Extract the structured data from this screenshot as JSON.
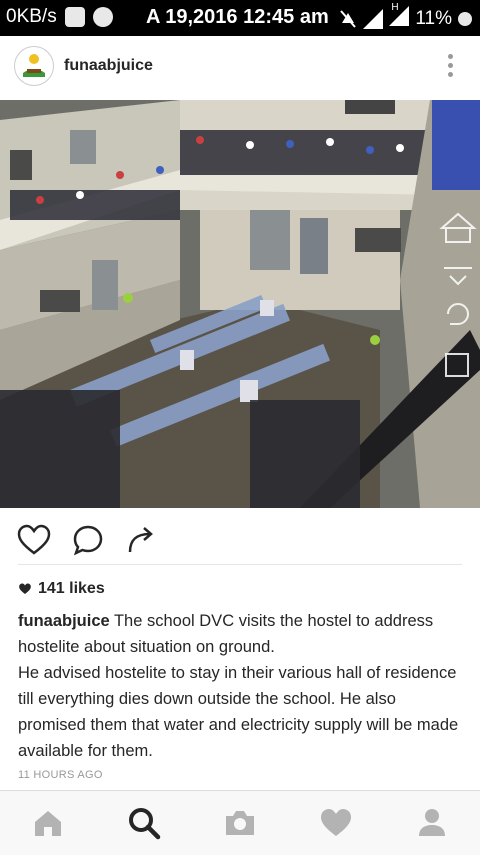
{
  "statusbar": {
    "data_text": "0KB/s",
    "datetime": "A 19,2016 12:45 am",
    "network": "H",
    "battery": "11%"
  },
  "post": {
    "username": "funaabjuice",
    "likes": "141 likes",
    "caption_user": "funaabjuice",
    "caption_text": " The school DVC visits the hostel to address hostelite about situation on ground.\nHe advised hostelite to stay in their various hall of residence till everything dies down outside the school. He also promised them that water and electricity supply will be made available for them.",
    "time": "11 HOURS AGO"
  },
  "icons": {
    "more": "more-vertical-icon",
    "like": "heart-outline-icon",
    "comment": "comment-bubble-icon",
    "share": "share-arrow-icon",
    "nav": [
      "home-icon",
      "search-icon",
      "camera-icon",
      "heart-icon",
      "profile-icon"
    ]
  },
  "colors": {
    "active_nav": "#262626",
    "inactive_nav": "#b3b3b3",
    "statusbar_bg": "#000000"
  }
}
